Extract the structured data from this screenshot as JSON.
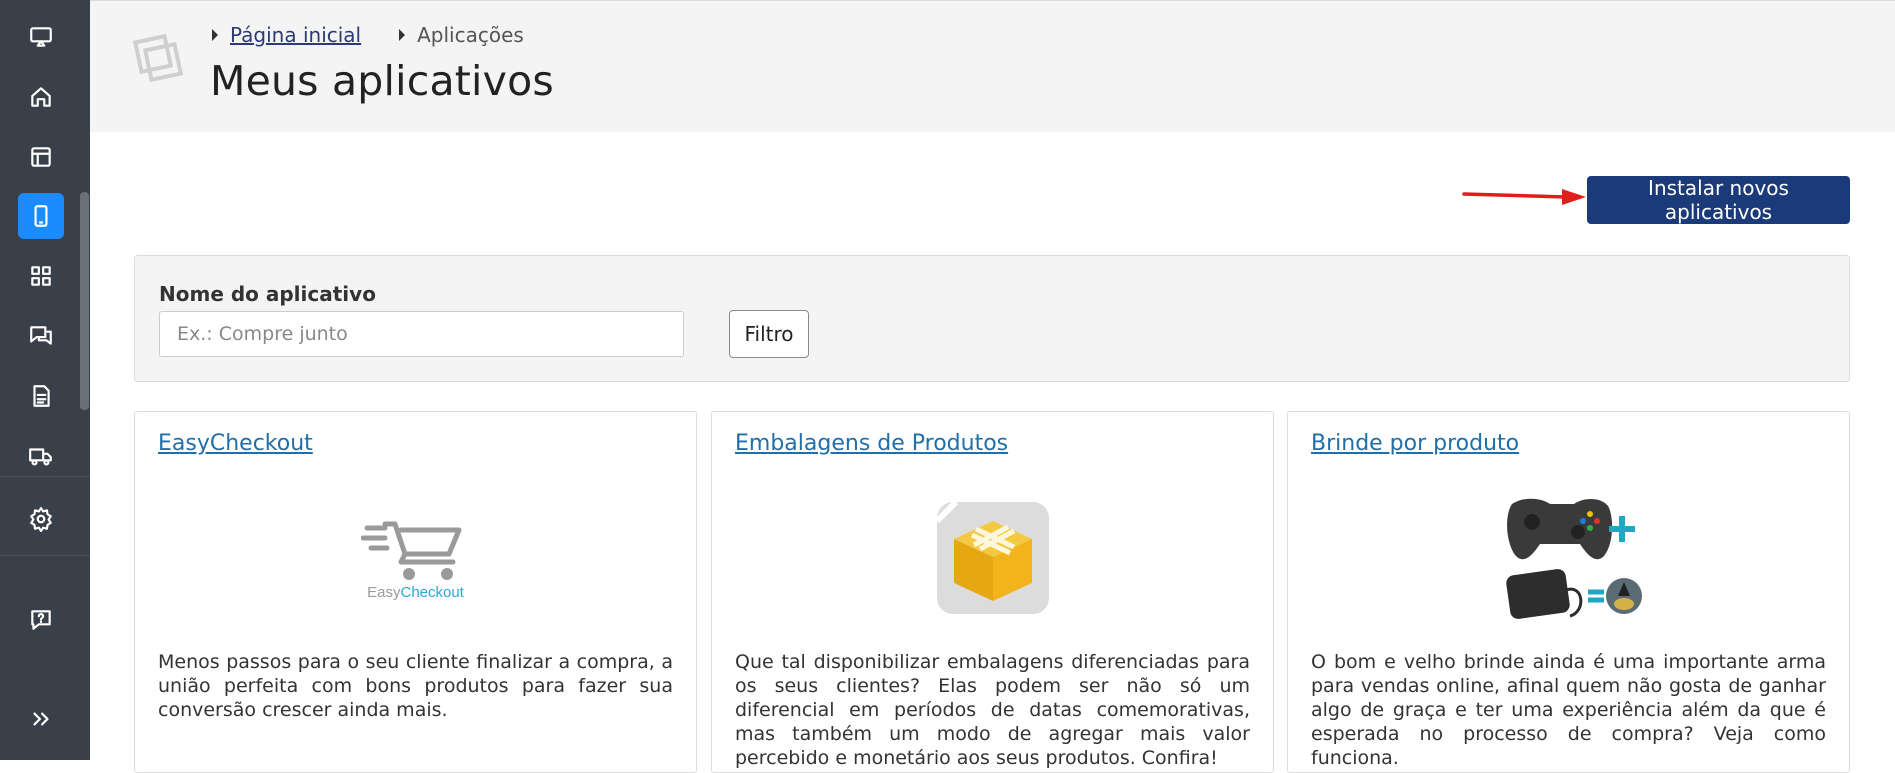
{
  "breadcrumb": {
    "home": "Página inicial",
    "current": "Aplicações"
  },
  "page": {
    "title": "Meus aplicativos"
  },
  "actions": {
    "install_label": "Instalar novos aplicativos"
  },
  "filter": {
    "label": "Nome do aplicativo",
    "placeholder": "Ex.: Compre junto",
    "button_label": "Filtro"
  },
  "sidebar": {
    "items": [
      {
        "icon": "cast-icon"
      },
      {
        "icon": "home-icon"
      },
      {
        "icon": "layout-icon"
      },
      {
        "icon": "mobile-icon",
        "active": true
      },
      {
        "icon": "grid-icon"
      },
      {
        "icon": "chat-icon"
      },
      {
        "icon": "document-icon"
      },
      {
        "icon": "truck-icon"
      },
      {
        "icon": "gear-icon"
      },
      {
        "icon": "help-chat-icon"
      },
      {
        "icon": "double-chevron-right-icon"
      }
    ]
  },
  "cards": [
    {
      "title": "EasyCheckout",
      "logo_text_1": "Easy",
      "logo_text_2": "Checkout",
      "description": "Menos passos para o seu cliente finalizar a compra, a união perfeita com bons produtos para fazer sua conversão crescer ainda mais."
    },
    {
      "title": "Embalagens de Produtos",
      "description": "Que tal disponibilizar embalagens diferenciadas para os seus clientes? Elas podem ser não só um diferencial em períodos de datas comemorativas, mas também um modo de agregar mais valor percebido e monetário aos seus produtos. Confira!"
    },
    {
      "title": "Brinde por produto",
      "description": "O bom e velho brinde ainda é uma importante arma para vendas online, afinal quem não gosta de ganhar algo de graça e ter uma experiência além da que é esperada no processo de compra? Veja como funciona."
    }
  ],
  "colors": {
    "sidebar_bg": "#3a4049",
    "active_item": "#1a8cff",
    "primary_button": "#1b3a7a",
    "link": "#1f6fa8",
    "annotation_arrow": "#e51c1c"
  }
}
